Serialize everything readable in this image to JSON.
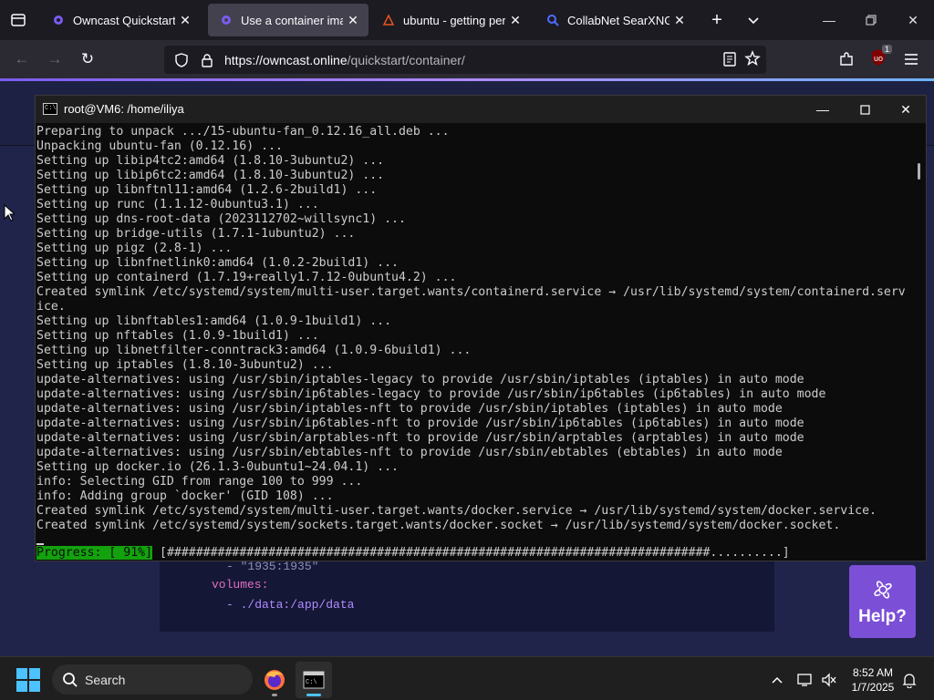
{
  "browser": {
    "tabs": [
      {
        "title": "Owncast Quickstart - O",
        "active": false,
        "icon": "owncast-icon"
      },
      {
        "title": "Use a container image",
        "active": true,
        "icon": "owncast-icon"
      },
      {
        "title": "ubuntu - getting perm",
        "active": false,
        "icon": "askubuntu-icon"
      },
      {
        "title": "CollabNet SearXNG",
        "active": false,
        "icon": "search-icon"
      }
    ],
    "url_host": "https://owncast.online",
    "url_path": "/quickstart/container/",
    "extension_badge": "1"
  },
  "page": {
    "code_lines": [
      {
        "text": "- \"1935:1935\"",
        "color": "#8d8fb8"
      },
      {
        "text": "volumes:",
        "color": "#e070c0"
      },
      {
        "text": "- ./data:/app/data",
        "color": "#b08cff"
      }
    ],
    "help_label": "Help?"
  },
  "terminal": {
    "title": "root@VM6: /home/iliya",
    "lines": [
      "Preparing to unpack .../15-ubuntu-fan_0.12.16_all.deb ...",
      "Unpacking ubuntu-fan (0.12.16) ...",
      "Setting up libip4tc2:amd64 (1.8.10-3ubuntu2) ...",
      "Setting up libip6tc2:amd64 (1.8.10-3ubuntu2) ...",
      "Setting up libnftnl11:amd64 (1.2.6-2build1) ...",
      "Setting up runc (1.1.12-0ubuntu3.1) ...",
      "Setting up dns-root-data (2023112702~willsync1) ...",
      "Setting up bridge-utils (1.7.1-1ubuntu2) ...",
      "Setting up pigz (2.8-1) ...",
      "Setting up libnfnetlink0:amd64 (1.0.2-2build1) ...",
      "Setting up containerd (1.7.19+really1.7.12-0ubuntu4.2) ...",
      "Created symlink /etc/systemd/system/multi-user.target.wants/containerd.service → /usr/lib/systemd/system/containerd.serv",
      "ice.",
      "Setting up libnftables1:amd64 (1.0.9-1build1) ...",
      "Setting up nftables (1.0.9-1build1) ...",
      "Setting up libnetfilter-conntrack3:amd64 (1.0.9-6build1) ...",
      "Setting up iptables (1.8.10-3ubuntu2) ...",
      "update-alternatives: using /usr/sbin/iptables-legacy to provide /usr/sbin/iptables (iptables) in auto mode",
      "update-alternatives: using /usr/sbin/ip6tables-legacy to provide /usr/sbin/ip6tables (ip6tables) in auto mode",
      "update-alternatives: using /usr/sbin/iptables-nft to provide /usr/sbin/iptables (iptables) in auto mode",
      "update-alternatives: using /usr/sbin/ip6tables-nft to provide /usr/sbin/ip6tables (ip6tables) in auto mode",
      "update-alternatives: using /usr/sbin/arptables-nft to provide /usr/sbin/arptables (arptables) in auto mode",
      "update-alternatives: using /usr/sbin/ebtables-nft to provide /usr/sbin/ebtables (ebtables) in auto mode",
      "Setting up docker.io (26.1.3-0ubuntu1~24.04.1) ...",
      "info: Selecting GID from range 100 to 999 ...",
      "info: Adding group `docker' (GID 108) ...",
      "Created symlink /etc/systemd/system/multi-user.target.wants/docker.service → /usr/lib/systemd/system/docker.service.",
      "Created symlink /etc/systemd/system/sockets.target.wants/docker.socket → /usr/lib/systemd/system/docker.socket.",
      ""
    ],
    "progress_label": "Progress: [ 91%]",
    "progress_bar": "[###########################################################################..........]",
    "progress_percent": 91
  },
  "taskbar": {
    "search_placeholder": "Search",
    "time": "8:52 AM",
    "date": "1/7/2025",
    "accent": "#4cc2ff"
  }
}
